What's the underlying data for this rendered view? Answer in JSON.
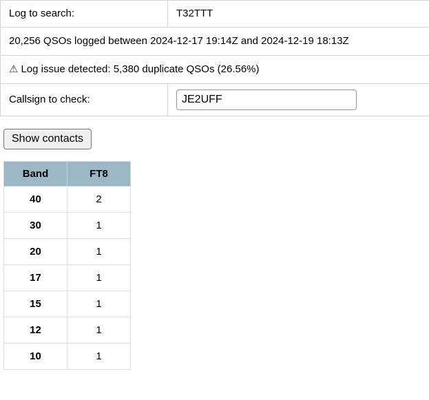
{
  "info": {
    "log_label": "Log to search:",
    "log_value": "T32TTT",
    "summary": "20,256 QSOs logged between 2024-12-17 19:14Z and 2024-12-19 18:13Z",
    "warning_icon": "⚠",
    "warning_text": "Log issue detected: 5,380 duplicate QSOs (26.56%)",
    "callsign_label": "Callsign to check:",
    "callsign_value": "JE2UFF",
    "callsign_placeholder": ""
  },
  "actions": {
    "show_contacts_label": "Show contacts"
  },
  "band_table": {
    "columns": [
      "Band",
      "FT8"
    ],
    "rows": [
      {
        "band": "40",
        "ft8": "2"
      },
      {
        "band": "30",
        "ft8": "1"
      },
      {
        "band": "20",
        "ft8": "1"
      },
      {
        "band": "17",
        "ft8": "1"
      },
      {
        "band": "15",
        "ft8": "1"
      },
      {
        "band": "12",
        "ft8": "1"
      },
      {
        "band": "10",
        "ft8": "1"
      }
    ]
  },
  "colors": {
    "header_bg": "#9cb8c5",
    "border": "#d2d2d2",
    "button_bg": "#efefef",
    "input_border": "#949494"
  }
}
